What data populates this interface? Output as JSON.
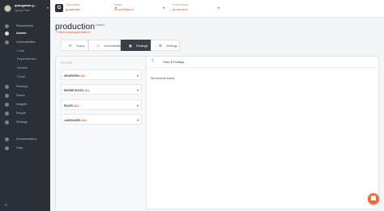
{
  "user": {
    "name": "quangpham-g...",
    "subtitle": "Quang Pham"
  },
  "sidebar": {
    "items": [
      {
        "label": "Repositories",
        "icon": "repo-icon"
      },
      {
        "label": "Assets",
        "icon": "assets-icon",
        "active": true
      },
      {
        "label": "Vulnerabilities",
        "icon": "shield-icon"
      },
      {
        "label": "Code",
        "sub": true
      },
      {
        "label": "Dependencies",
        "sub": true
      },
      {
        "label": "Secrets",
        "sub": true
      },
      {
        "label": "Cloud",
        "sub": true
      },
      {
        "label": "Findings",
        "icon": "findings-icon"
      },
      {
        "label": "Scans",
        "icon": "scans-icon"
      },
      {
        "label": "Insights",
        "icon": "insights-icon"
      },
      {
        "label": "People",
        "icon": "people-icon"
      },
      {
        "label": "Settings",
        "icon": "gear-icon"
      },
      {
        "label": "Documentation",
        "icon": "docs-icon"
      },
      {
        "label": "Help",
        "icon": "help-icon"
      }
    ],
    "collapse_icon": "collapse-icon"
  },
  "topbar": {
    "organization": {
      "caption": "Organization",
      "value": "guardrails"
    },
    "asset": {
      "caption": "Assets",
      "value": "GuardRails.io"
    },
    "environment": {
      "caption": "Environments",
      "value": "production"
    }
  },
  "page": {
    "title": "production",
    "badge": "Default",
    "url": "↗ https://www.guardrails.io/"
  },
  "tabs": [
    {
      "label": "Scans",
      "icon": "scans-icon"
    },
    {
      "label": "Vulnerabilities",
      "icon": "bug-icon"
    },
    {
      "label": "Findings",
      "icon": "findings-icon",
      "active": true
    },
    {
      "label": "Settings",
      "icon": "gear-icon"
    }
  ],
  "filters": {
    "header": "FILTERS",
    "rows": [
      {
        "key": "SEVERITIES:",
        "value": "ALL"
      },
      {
        "key": "ENGINE RULES:",
        "value": "ALL"
      },
      {
        "key": "RULES:",
        "value": "ALL"
      },
      {
        "key": "LANGUAGES:",
        "value": "ALL"
      }
    ]
  },
  "results": {
    "total_label": "Total:",
    "total_count": "0",
    "total_suffix": "Findings",
    "empty_message": "No records found"
  },
  "colors": {
    "accent": "#e0592a",
    "sidebar": "#2b2f36",
    "chat": "#f26b3a"
  }
}
